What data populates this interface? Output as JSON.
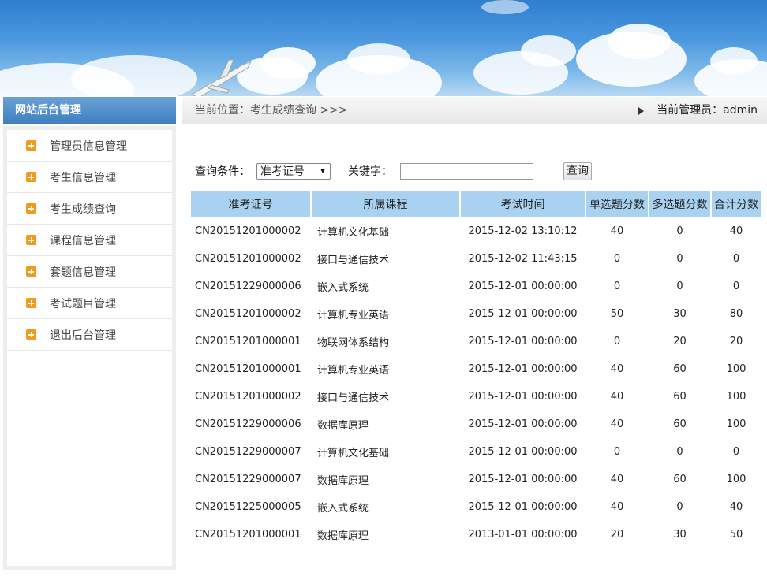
{
  "breadcrumb": {
    "location": "当前位置：考生成绩查询 >>>",
    "admin": "当前管理员：admin"
  },
  "sidebar": {
    "title": "网站后台管理",
    "items": [
      {
        "label": "管理员信息管理"
      },
      {
        "label": "考生信息管理"
      },
      {
        "label": "考生成绩查询"
      },
      {
        "label": "课程信息管理"
      },
      {
        "label": "套题信息管理"
      },
      {
        "label": "考试题目管理"
      },
      {
        "label": "退出后台管理"
      }
    ]
  },
  "search": {
    "condition_label": "查询条件：",
    "condition_selected": "准考证号",
    "keyword_label": "关键字：",
    "keyword_value": "",
    "query_button": "查询"
  },
  "table": {
    "headers": [
      "准考证号",
      "所属课程",
      "考试时间",
      "单选题分数",
      "多选题分数",
      "合计分数"
    ],
    "rows": [
      [
        "CN20151201000002",
        "计算机文化基础",
        "2015-12-02 13:10:12",
        "40",
        "0",
        "40"
      ],
      [
        "CN20151201000002",
        "接口与通信技术",
        "2015-12-02 11:43:15",
        "0",
        "0",
        "0"
      ],
      [
        "CN20151229000006",
        "嵌入式系统",
        "2015-12-01 00:00:00",
        "0",
        "0",
        "0"
      ],
      [
        "CN20151201000002",
        "计算机专业英语",
        "2015-12-01 00:00:00",
        "50",
        "30",
        "80"
      ],
      [
        "CN20151201000001",
        "物联网体系结构",
        "2015-12-01 00:00:00",
        "0",
        "20",
        "20"
      ],
      [
        "CN20151201000001",
        "计算机专业英语",
        "2015-12-01 00:00:00",
        "40",
        "60",
        "100"
      ],
      [
        "CN20151201000002",
        "接口与通信技术",
        "2015-12-01 00:00:00",
        "40",
        "60",
        "100"
      ],
      [
        "CN20151229000006",
        "数据库原理",
        "2015-12-01 00:00:00",
        "40",
        "60",
        "100"
      ],
      [
        "CN20151229000007",
        "计算机文化基础",
        "2015-12-01 00:00:00",
        "0",
        "0",
        "0"
      ],
      [
        "CN20151229000007",
        "数据库原理",
        "2015-12-01 00:00:00",
        "40",
        "60",
        "100"
      ],
      [
        "CN20151225000005",
        "嵌入式系统",
        "2015-12-01 00:00:00",
        "40",
        "0",
        "40"
      ],
      [
        "CN20151201000001",
        "数据库原理",
        "2013-01-01 00:00:00",
        "20",
        "30",
        "50"
      ]
    ]
  }
}
